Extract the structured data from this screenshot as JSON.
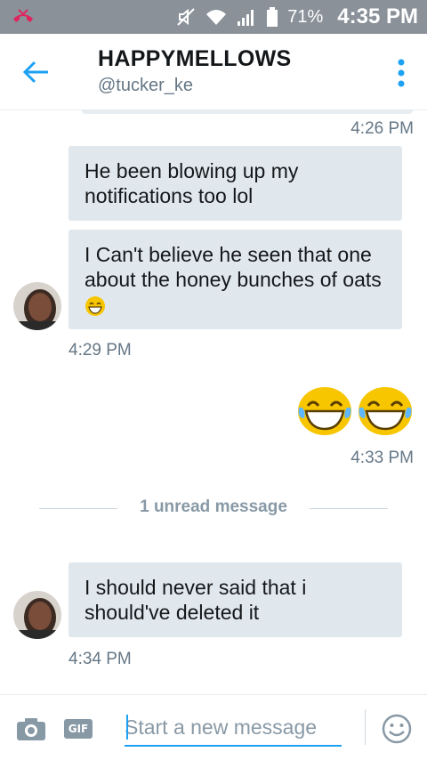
{
  "status_bar": {
    "battery": "71%",
    "time": "4:35 PM"
  },
  "header": {
    "title": "HAPPYMELLOWS",
    "handle": "@tucker_ke"
  },
  "messages": [
    {
      "text": "He been blowing up my notifications too lol"
    },
    {
      "text": "I Can't believe he seen that one about the honey bunches of oats"
    },
    {
      "text": "I should never said that i should've deleted it"
    }
  ],
  "timestamps": {
    "t1": "4:26 PM",
    "t2": "4:29 PM",
    "t3": "4:33 PM",
    "t4": "4:34 PM"
  },
  "divider": {
    "label": "1 unread message"
  },
  "composer": {
    "placeholder": "Start a new message",
    "gif_label": "GIF"
  },
  "icons": {
    "back": "arrow-left-icon",
    "more": "more-vertical-icon",
    "camera": "camera-icon",
    "gif": "gif-icon",
    "emoji": "smiley-icon"
  },
  "colors": {
    "accent": "#1da1f2",
    "bubble_received": "#e1e8ed",
    "status_bar": "#8a9199",
    "emoji_yellow": "#f7c600"
  }
}
